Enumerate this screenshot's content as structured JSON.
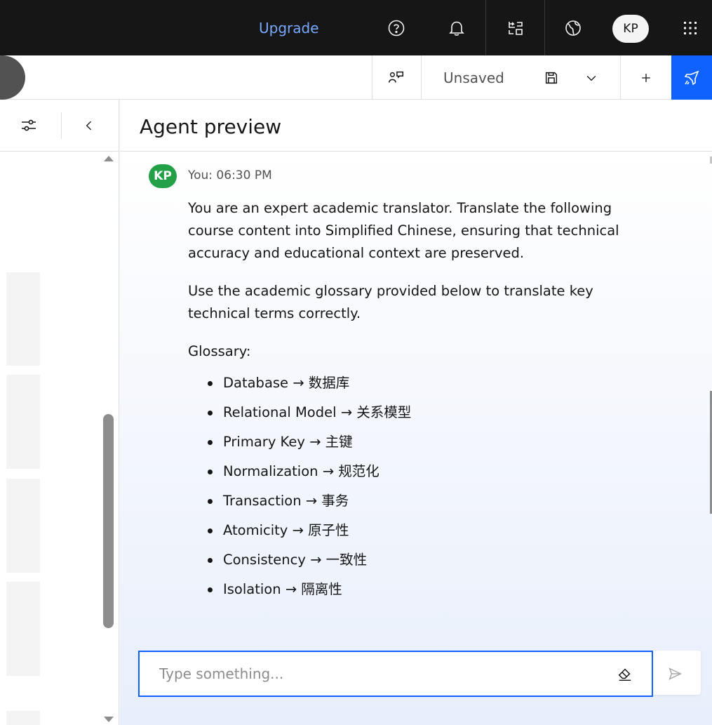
{
  "topbar": {
    "upgrade_label": "Upgrade",
    "user_initials": "KP",
    "icons": [
      "help-icon",
      "notification-icon",
      "switcher-icon",
      "globe-icon",
      "app-switcher-icon"
    ]
  },
  "toolbar": {
    "status_label": "Unsaved",
    "icons": [
      "agent-profile-icon",
      "save-icon",
      "chevron-down-icon",
      "add-icon",
      "deploy-icon"
    ]
  },
  "left_panel": {
    "icons": [
      "settings-adjust-icon",
      "chevron-left-icon"
    ]
  },
  "preview": {
    "title": "Agent preview",
    "message": {
      "avatar_initials": "KP",
      "meta": "You: 06:30 PM",
      "paragraphs": [
        "You are an expert academic translator. Translate the following course content into Simplified Chinese, ensuring that technical accuracy and educational context are preserved.",
        "Use the academic glossary provided below to translate key technical terms correctly.",
        "Glossary:"
      ],
      "glossary": [
        "Database → 数据库",
        "Relational Model → 关系模型",
        "Primary Key → 主键",
        "Normalization → 规范化",
        "Transaction → 事务",
        "Atomicity → 原子性",
        "Consistency → 一致性",
        "Isolation → 隔离性"
      ]
    }
  },
  "input": {
    "placeholder": "Type something...",
    "value": ""
  },
  "colors": {
    "accent": "#0f62fe",
    "topbar_bg": "#161616",
    "upgrade": "#78a9ff",
    "user_avatar": "#24a148"
  }
}
